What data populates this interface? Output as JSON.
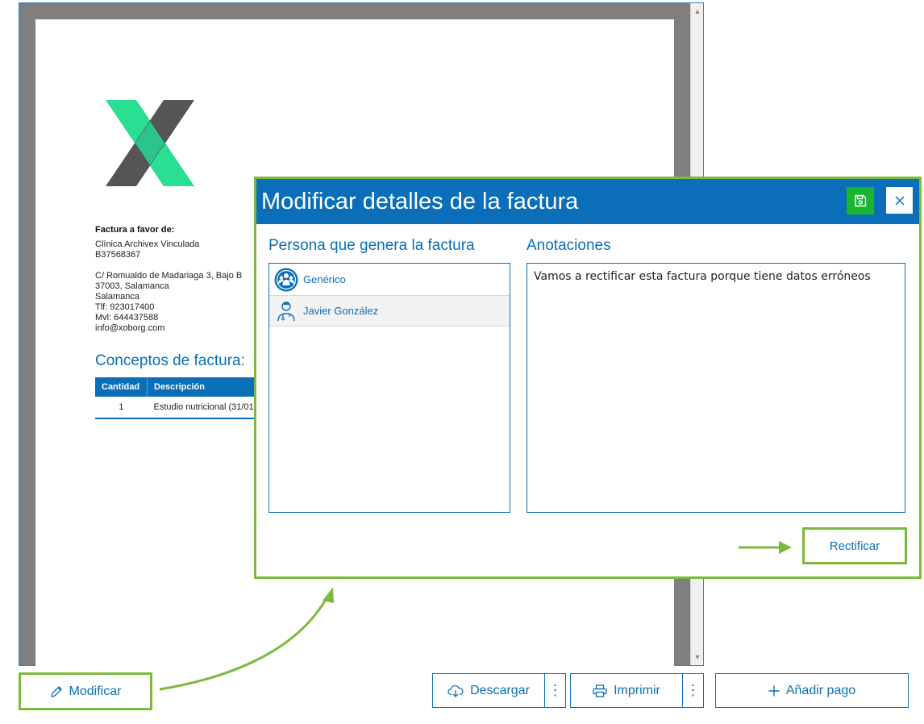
{
  "invoice": {
    "bill_heading": "Factura a favor de:",
    "client_name": "Clínica Archivex Vinculada",
    "client_tax_id": "B37568367",
    "address_line1": "C/ Romualdo de Madariaga 3, Bajo B",
    "address_line2": "37003, Salamanca",
    "city": "Salamanca",
    "phone": "Tlf: 923017400",
    "mobile": "Mvl: 644437588",
    "email": "info@xoborg.com",
    "concepts_title": "Conceptos de factura:",
    "table": {
      "headers": [
        "Cantidad",
        "Descripción"
      ],
      "rows": [
        {
          "qty": "1",
          "description": "Estudio nutricional (31/01"
        }
      ]
    }
  },
  "modal": {
    "title": "Modificar detalles de la factura",
    "persons_label": "Persona que genera la factura",
    "notes_label": "Anotaciones",
    "persons": [
      {
        "name": "Genérico",
        "icon": "group-icon",
        "selected": false
      },
      {
        "name": "Javier González",
        "icon": "doctor-icon",
        "selected": true
      }
    ],
    "notes_value": "Vamos a rectificar esta factura porque tiene datos erróneos",
    "rectificar_label": "Rectificar",
    "save_icon": "floppy-disk-icon",
    "close_icon": "close-icon"
  },
  "toolbar": {
    "modificar_label": "Modificar",
    "descargar_label": "Descargar",
    "imprimir_label": "Imprimir",
    "anadir_pago_label": "Añadir pago",
    "more_glyph": "⋮"
  },
  "colors": {
    "primary": "#0a6fb8",
    "highlight": "#7cba3d",
    "save_green": "#17b530",
    "logo_dark": "#555555",
    "logo_green": "#1fdc8e"
  }
}
